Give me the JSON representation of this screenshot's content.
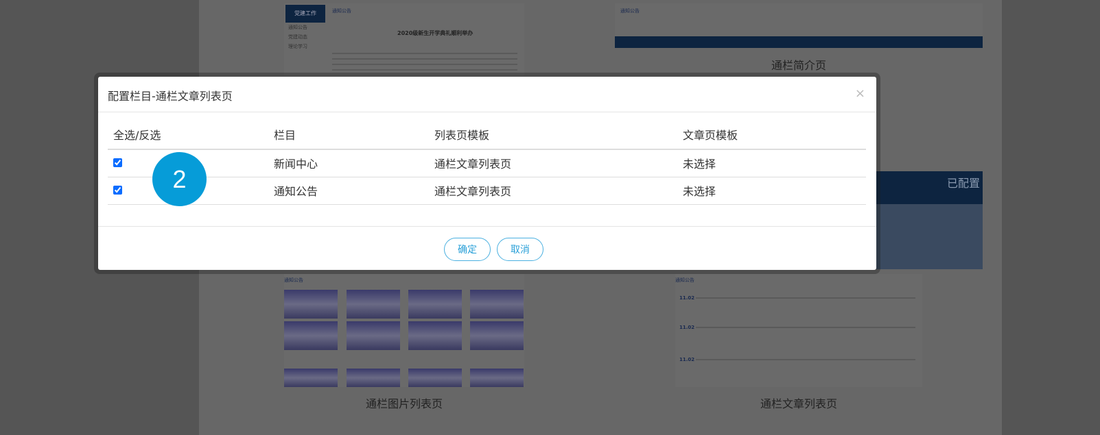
{
  "background": {
    "thumb1": {
      "sidebar_title": "党建工作",
      "sidebar_items": [
        "通知公告",
        "党建动态",
        "理论学习"
      ],
      "header": "通知公告",
      "article_title": "2020级新生开学典礼顺利举办"
    },
    "thumb2": {
      "header": "通知公告",
      "caption": "通栏简介页"
    },
    "thumb3": {
      "status": "已配置"
    },
    "thumb4": {
      "header": "通知公告",
      "caption": "通栏图片列表页"
    },
    "thumb5": {
      "header": "通知公告",
      "dates": [
        "11.02",
        "11.02",
        "11.02"
      ],
      "caption": "通栏文章列表页"
    }
  },
  "modal": {
    "title": "配置栏目-通栏文章列表页",
    "close_icon": "×",
    "columns": [
      "全选/反选",
      "栏目",
      "列表页模板",
      "文章页模板"
    ],
    "rows": [
      {
        "checked": true,
        "column": "新闻中心",
        "list_template": "通栏文章列表页",
        "article_template": "未选择"
      },
      {
        "checked": true,
        "column": "通知公告",
        "list_template": "通栏文章列表页",
        "article_template": "未选择"
      }
    ],
    "confirm_label": "确定",
    "cancel_label": "取消"
  },
  "step_badge": "2",
  "colors": {
    "accent": "#069cd8",
    "button_border": "#4ab0e0",
    "navy": "#0d2440"
  }
}
